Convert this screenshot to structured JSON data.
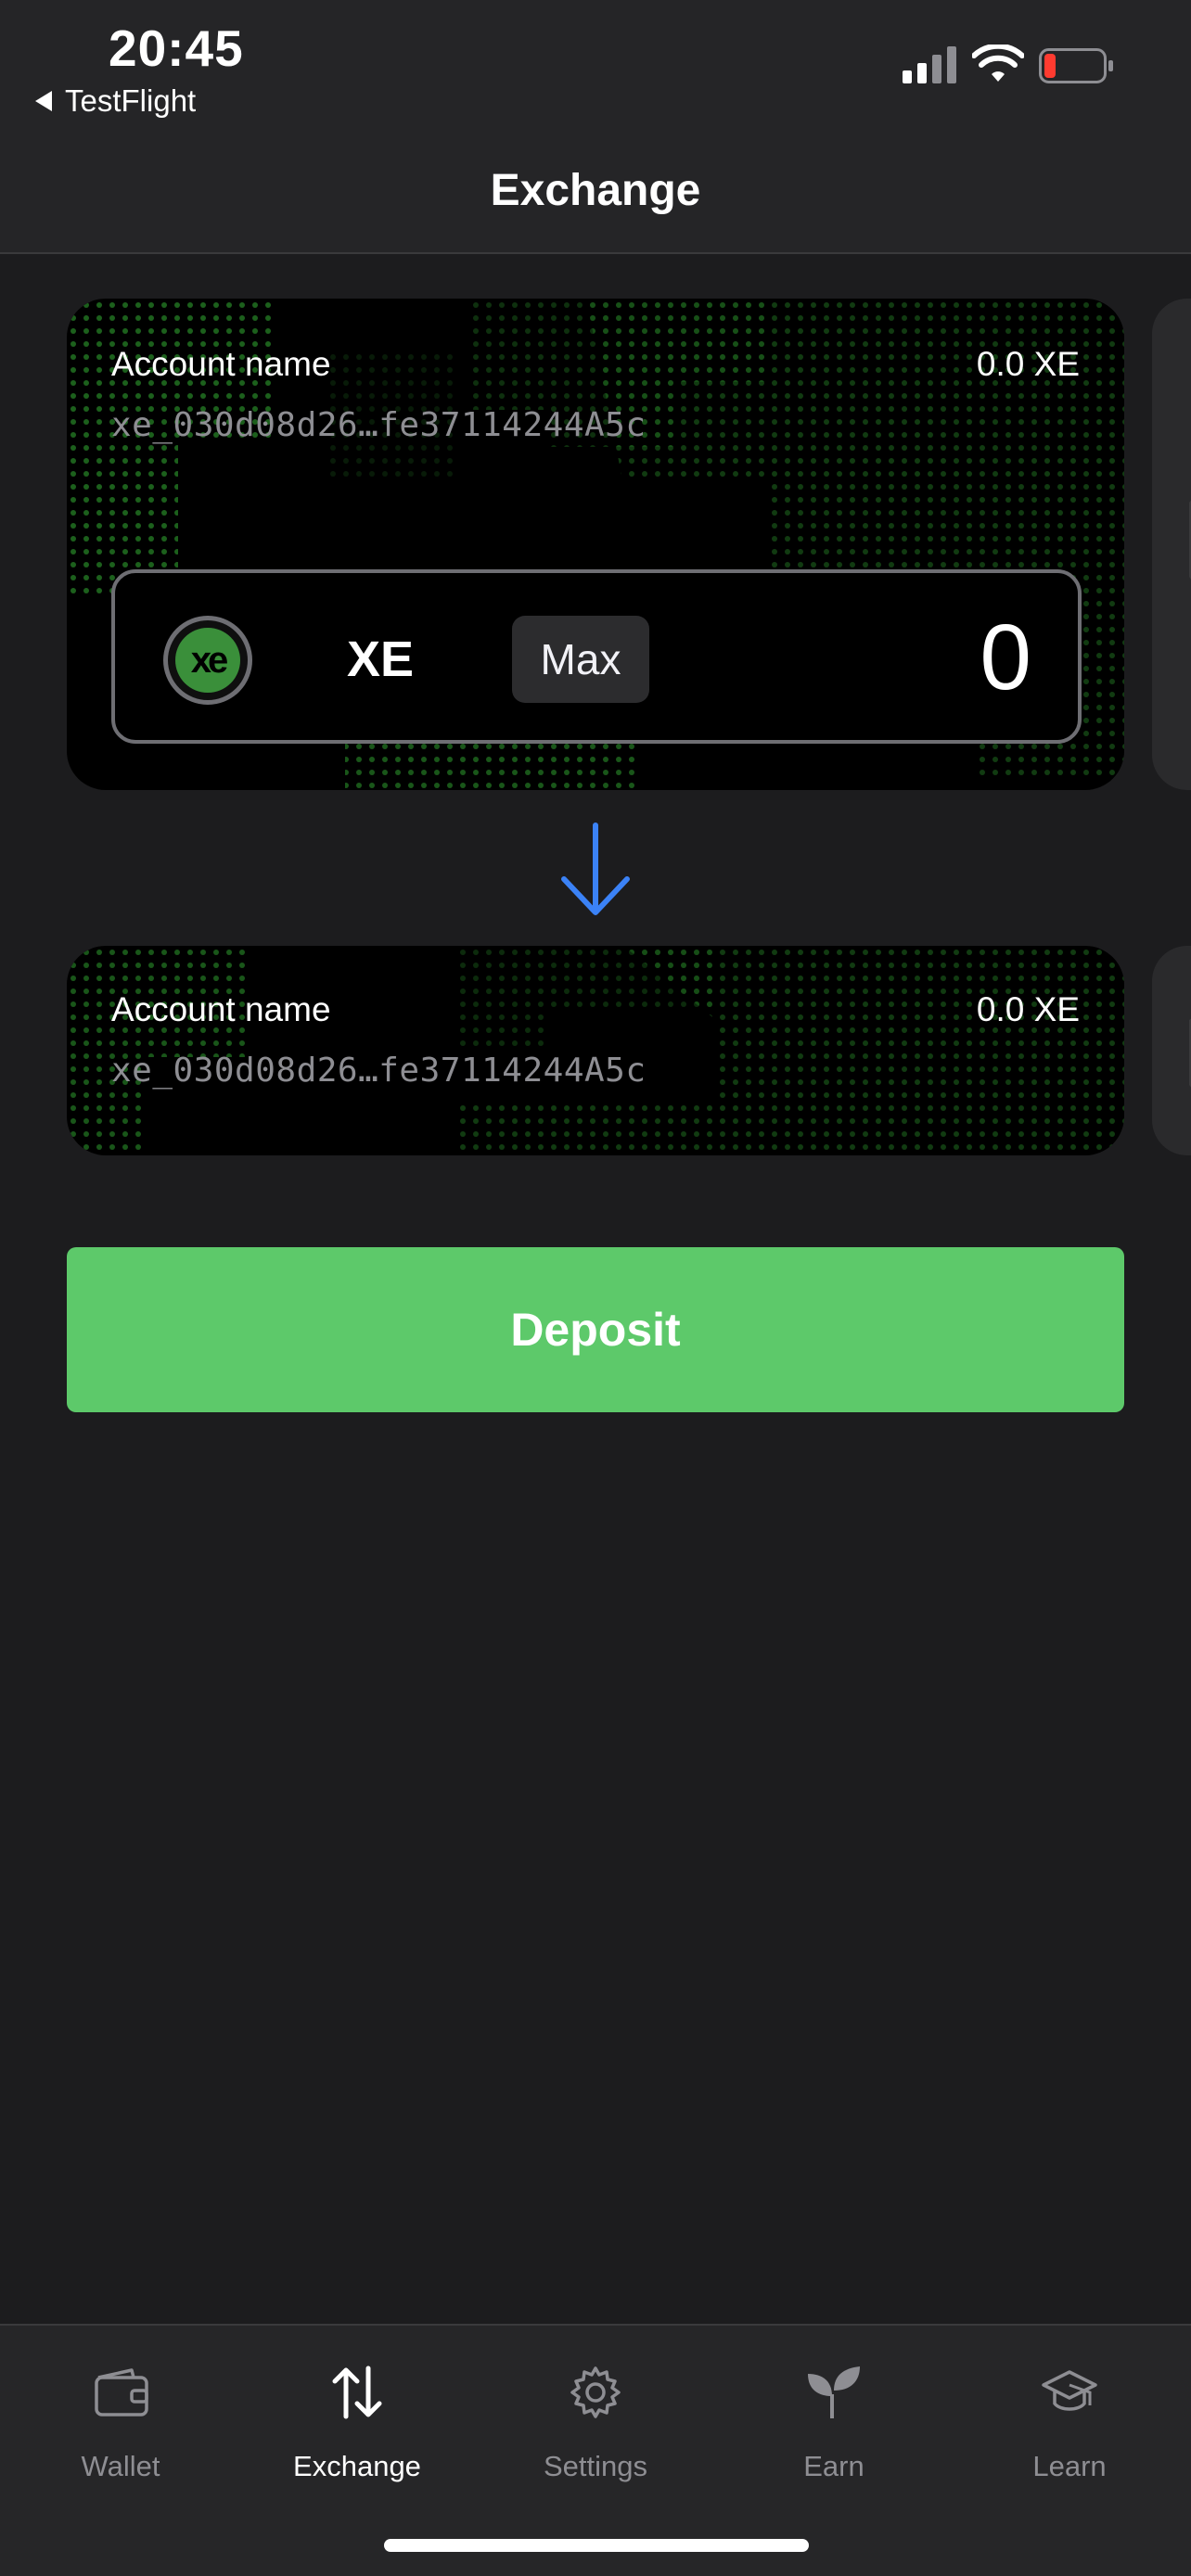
{
  "status_bar": {
    "time": "20:45",
    "back_label": "TestFlight"
  },
  "header": {
    "title": "Exchange"
  },
  "from_card": {
    "account_name": "Account name",
    "balance": "0.0 XE",
    "address": "xe_030d08d26…fe37114244A5c",
    "token_logo_text": "xe",
    "token_symbol": "XE",
    "max_label": "Max",
    "amount": "0"
  },
  "to_card": {
    "account_name": "Account name",
    "balance": "0.0 XE",
    "address": "xe_030d08d26…fe37114244A5c"
  },
  "deposit_label": "Deposit",
  "tabs": [
    {
      "label": "Wallet",
      "icon": "wallet-icon",
      "active": false
    },
    {
      "label": "Exchange",
      "icon": "exchange-icon",
      "active": true
    },
    {
      "label": "Settings",
      "icon": "gear-icon",
      "active": false
    },
    {
      "label": "Earn",
      "icon": "sprout-icon",
      "active": false
    },
    {
      "label": "Learn",
      "icon": "graduation-cap-icon",
      "active": false
    }
  ],
  "colors": {
    "background": "#1c1c1e",
    "accent_green": "#5dc96a",
    "arrow_blue": "#3b82f6",
    "dot_green": "#1f6b1f"
  }
}
